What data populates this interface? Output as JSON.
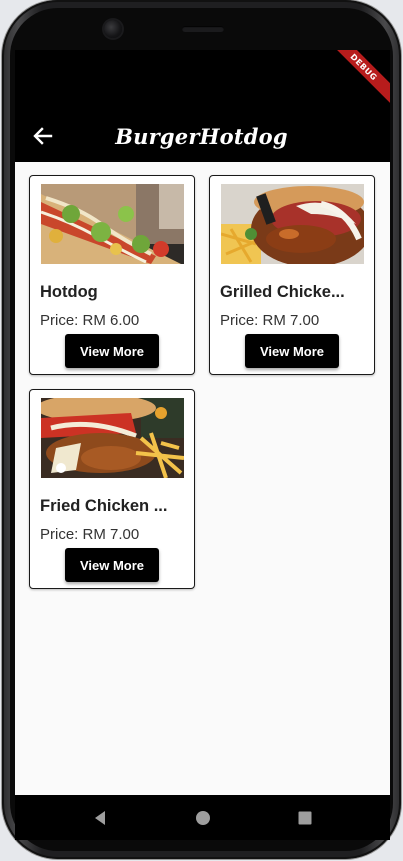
{
  "appbar": {
    "title": "BurgerHotdog"
  },
  "debug_banner": "DEBUG",
  "products": [
    {
      "name": "Hotdog",
      "price": "Price: RM 6.00",
      "button": "View More"
    },
    {
      "name": "Grilled Chicke...",
      "price": "Price: RM 7.00",
      "button": "View More"
    },
    {
      "name": "Fried Chicken ...",
      "price": "Price: RM 7.00",
      "button": "View More"
    }
  ],
  "icons": {
    "back": "arrow-back-icon",
    "nav_back": "triangle-back-icon",
    "nav_home": "circle-home-icon",
    "nav_recents": "square-recents-icon"
  },
  "colors": {
    "appbar": "#000000",
    "button": "#000000",
    "background": "#fafafa"
  }
}
